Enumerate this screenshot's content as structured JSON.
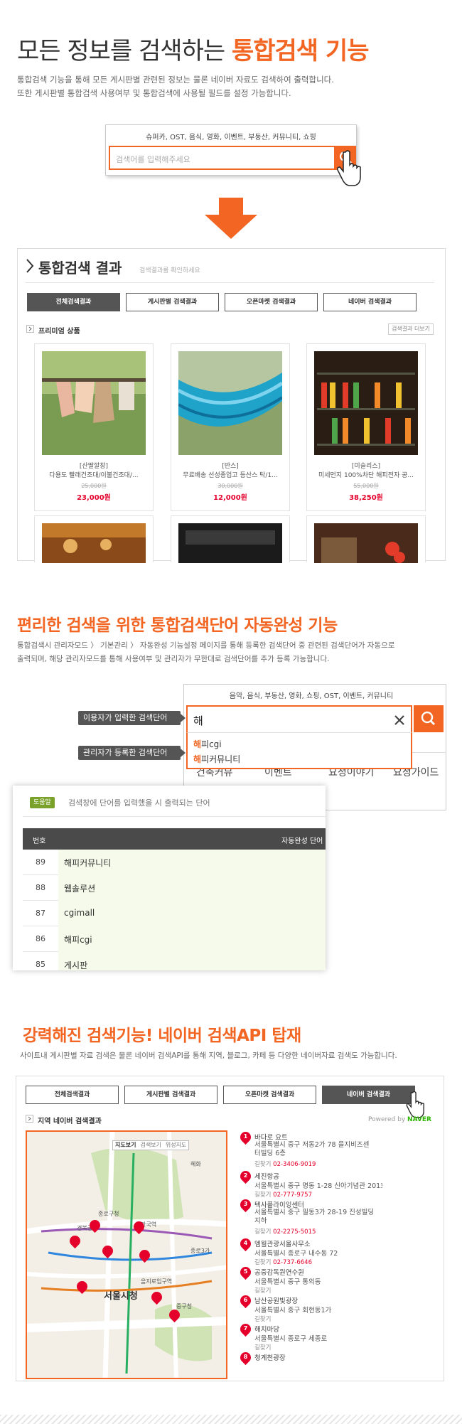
{
  "section1": {
    "title_plain": "모든 정보를 검색하는 ",
    "title_accent": "통합검색 기능",
    "desc_line1": "통합검색 기능을 통해 모든 게시판별 관련된 정보는 물론 네이버 자료도 검색하여 출력합니다.",
    "desc_line2": "또한 게시판별 통합검색 사용여부 및 통합검색에 사용될 필드를 설정 가능합니다.",
    "search": {
      "categories": "슈퍼카, OST, 음식, 영화, 이벤트, 부동산, 커뮤니티, 쇼핑",
      "placeholder": "검색어를 입력해주세요",
      "button_icon": "search-icon"
    }
  },
  "results": {
    "title": "통합검색 결과",
    "subtitle": "검색결과를 확인하세요",
    "tabs": [
      "전체검색결과",
      "게시판별 검색결과",
      "오픈마켓 검색결과",
      "네이버 검색결과"
    ],
    "active_tab": 0,
    "section_label": "프리미엄 상품",
    "more_label": "검색결과 더보기",
    "products": [
      {
        "brand": "[산딸깔창]",
        "name": "다용도 빨래건조대/이불건조대/...",
        "old_price": "25,000원",
        "price": "23,000원"
      },
      {
        "brand": "[반스]",
        "name": "무료배송 선성종업고 등산스 탁/1...",
        "old_price": "30,000원",
        "price": "12,000원"
      },
      {
        "brand": "[미슬리스]",
        "name": "미세먼지 100%차단 해피전자 공...",
        "old_price": "55,000원",
        "price": "38,250원"
      }
    ]
  },
  "section2": {
    "title": "편리한 검색을 위한 통합검색단어 자동완성 기능",
    "desc_line1": "통합검색시 관리자모드 〉 기본관리 〉 자동완성 기능설정 페이지를 통해 등록한 검색단어 중 관련된 검색단어가 자동으로",
    "desc_line2": "출력되며, 해당 관리자모드를 통해 사용여부 및 관리자가 무한대로 검색단어를 추가 등록 가능합니다.",
    "search_categories": "음악, 음식, 부동산, 영화, 쇼핑, OST, 이벤트, 커뮤니티",
    "typed": "해",
    "suggestions": [
      {
        "hl": "해",
        "rest": "피cgi"
      },
      {
        "hl": "해",
        "rest": "피커뮤니티"
      }
    ],
    "bg_tabs": [
      "건축커뮤",
      "이벤트",
      "요정이야기",
      "요정가이드"
    ],
    "label_user": "이용자가 입력한 검색단어",
    "label_admin": "관리자가 등록한 검색단어",
    "help_badge": "도움말",
    "help_text": "검색창에 단어를 입력했을 시 출력되는 단어",
    "col_no": "번호",
    "col_kw": "자동완성 단어",
    "rows": [
      {
        "no": "89",
        "kw": "해피커뮤니티"
      },
      {
        "no": "88",
        "kw": "웹솔루션"
      },
      {
        "no": "87",
        "kw": "cgimall"
      },
      {
        "no": "86",
        "kw": "해피cgi"
      },
      {
        "no": "85",
        "kw": "게시판"
      }
    ]
  },
  "section3": {
    "title": "강력해진 검색기능! 네이버 검색API 탑재",
    "desc": "사이트내 게시판별 자료 검색은 물론 네이버 검색API를 통해 지역, 블로그, 카페 등 다양한 네이버자료 검색도 가능합니다.",
    "tabs": [
      "전체검색결과",
      "게시판별 검색결과",
      "오픈마켓 검색결과",
      "네이버 검색결과"
    ],
    "active_tab": 3,
    "section_label": "지역 네이버 검색결과",
    "powered": "Powered by",
    "naver": "NAVER",
    "map_controls": [
      "지도보기",
      "검색보기",
      "위성지도"
    ],
    "map_labels": [
      "서울시청",
      "종로구청",
      "중구청",
      "혜화",
      "경복궁",
      "안국역",
      "을지로입구역",
      "종로3가"
    ],
    "places": [
      {
        "num": "1",
        "name": "바다로 요트",
        "addr": "서울특별시 중구 저동2가 78 을지비즈센터빌딩 6층",
        "tel_label": "길찾기",
        "tel": "02-3406-9019"
      },
      {
        "num": "2",
        "name": "세진항공",
        "addr": "서울특별시 중구 명동 1-28 신아기념관 201호",
        "tel_label": "길찾기",
        "tel": "02-777-9757"
      },
      {
        "num": "3",
        "name": "텍사플라이잉센터",
        "addr": "서울특별시 중구 필동3가 28-19 진성빌딩 지하",
        "tel_label": "길찾기",
        "tel": "02-2275-5015"
      },
      {
        "num": "4",
        "name": "엠월관광서울사무소",
        "addr": "서울특별시 종로구 내수동 72",
        "tel_label": "길찾기",
        "tel": "02-737-6646"
      },
      {
        "num": "5",
        "name": "공중감독원연수원",
        "addr": "서울특별시 중구 통의동",
        "tel_label": "길찾기",
        "tel": ""
      },
      {
        "num": "6",
        "name": "남산공원빛광장",
        "addr": "서울특별시 중구 회현동1가",
        "tel_label": "길찾기",
        "tel": ""
      },
      {
        "num": "7",
        "name": "해치마당",
        "addr": "서울특별시 종로구 세종로",
        "tel_label": "길찾기",
        "tel": ""
      },
      {
        "num": "8",
        "name": "청계천광장",
        "addr": "",
        "tel_label": "",
        "tel": ""
      }
    ]
  }
}
